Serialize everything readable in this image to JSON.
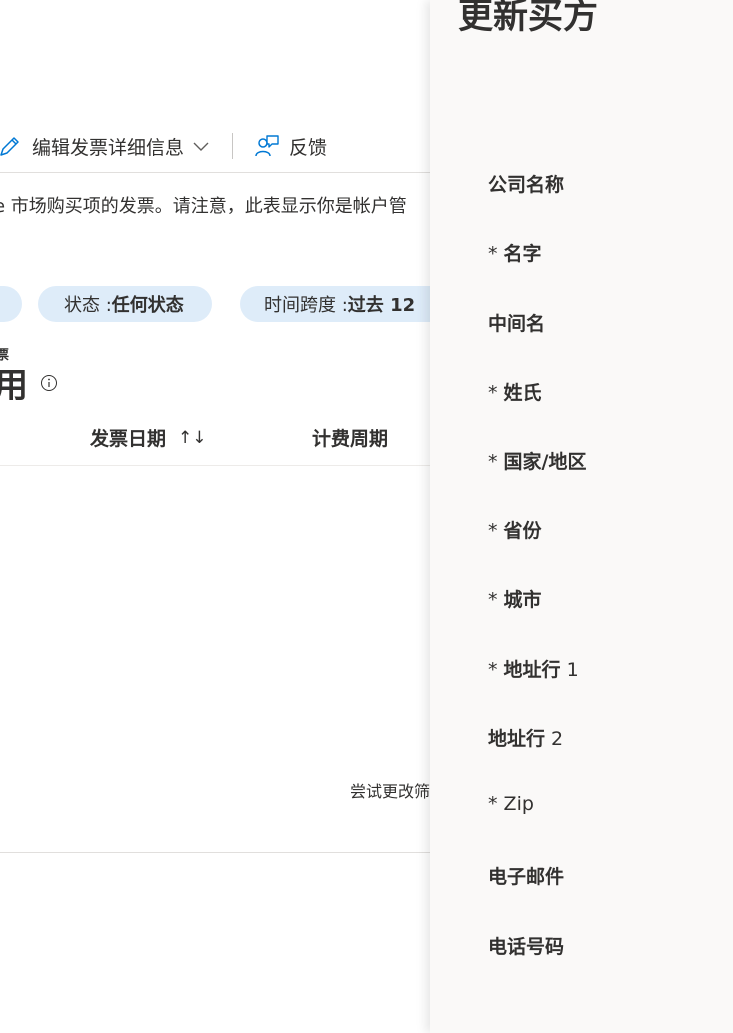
{
  "toolbar": {
    "edit_invoice_label": "编辑发票详细信息",
    "feedback_label": "反馈"
  },
  "description": "e 市场购买项的发票。请注意，此表显示你是帐户管",
  "filters": {
    "status_label": "状态 : ",
    "status_value": "任何状态",
    "timespan_label": "时间跨度 : ",
    "timespan_value": "过去 12"
  },
  "section": {
    "subheading": "票",
    "title": "用"
  },
  "table": {
    "columns": [
      "发票日期",
      "计费周期"
    ],
    "sort_glyph": "↑↓",
    "empty_text": "尝试更改筛"
  },
  "panel": {
    "title": "更新买方",
    "fields": [
      {
        "required": "",
        "label": "公司名称",
        "suffix": ""
      },
      {
        "required": "* ",
        "label": "名字",
        "suffix": ""
      },
      {
        "required": "",
        "label": "中间名",
        "suffix": ""
      },
      {
        "required": "* ",
        "label": "姓氏",
        "suffix": ""
      },
      {
        "required": "* ",
        "label": "国家/地区",
        "suffix": ""
      },
      {
        "required": "* ",
        "label": "省份",
        "suffix": ""
      },
      {
        "required": "* ",
        "label": "城市",
        "suffix": ""
      },
      {
        "required": "* ",
        "label": "地址行",
        "suffix": " 1"
      },
      {
        "required": "",
        "label": "地址行",
        "suffix": " 2"
      },
      {
        "required": "* ",
        "label": "Zip",
        "suffix": ""
      },
      {
        "required": "",
        "label": "电子邮件",
        "suffix": ""
      },
      {
        "required": "",
        "label": "电话号码",
        "suffix": ""
      }
    ]
  },
  "colors": {
    "accent": "#0078d4",
    "pill_bg": "#deecf9",
    "panel_bg": "#faf9f8",
    "text": "#323130"
  }
}
